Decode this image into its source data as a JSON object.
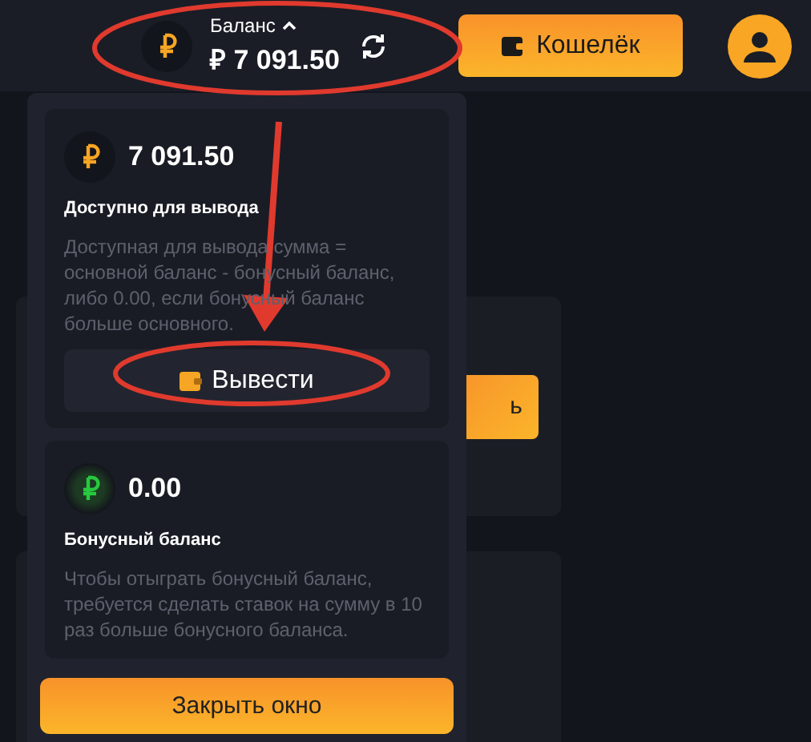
{
  "header": {
    "balance_label": "Баланс",
    "balance_amount": "₽ 7 091.50",
    "wallet_button": "Кошелёк"
  },
  "background": {
    "button": "ь"
  },
  "dropdown": {
    "cards": [
      {
        "kind": "main",
        "amount": "7 091.50",
        "title": "Доступно для вывода",
        "description": "Доступная для вывода сумма = основной баланс - бонусный баланс, либо 0.00, если бонусный баланс больше основного.",
        "button": "Вывести"
      },
      {
        "kind": "bonus",
        "amount": "0.00",
        "title": "Бонусный баланс",
        "description": "Чтобы отыграть бонусный баланс, требуется сделать ставок на сумму в 10 раз больше бонусного баланса."
      }
    ],
    "close_button": "Закрыть окно"
  }
}
